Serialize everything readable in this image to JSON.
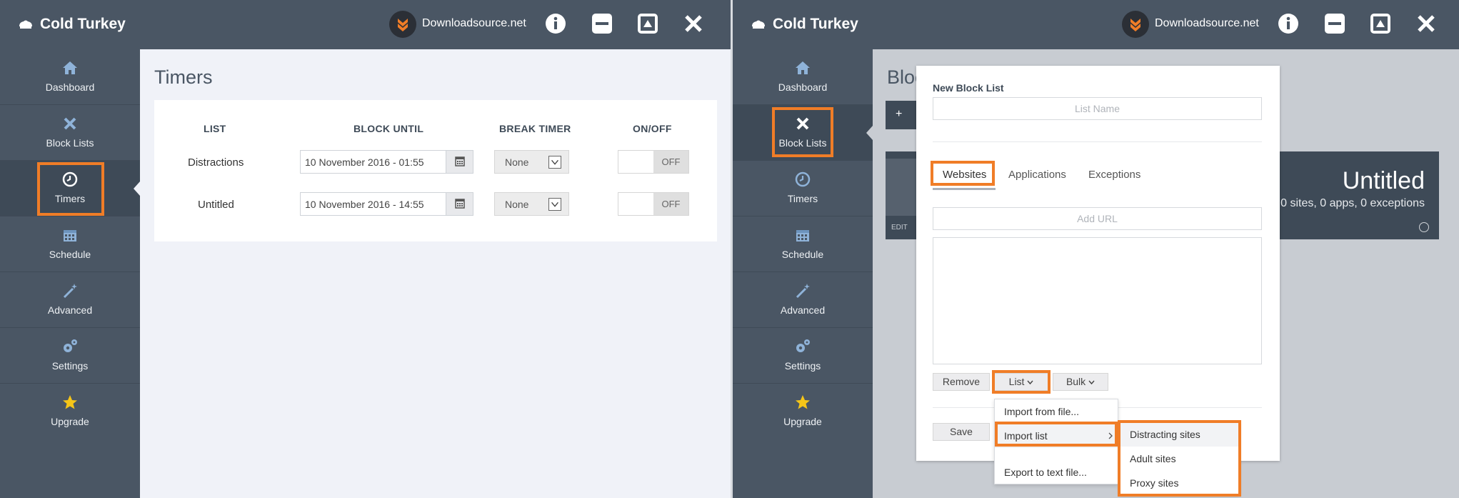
{
  "colors": {
    "titlebar": "#4a5664",
    "sidebar": "#4a5664",
    "highlight": "#f07d27",
    "content_bg": "#f0f2f8"
  },
  "left": {
    "titlebar": {
      "app_name": "Cold Turkey",
      "brand_text": "Downloadsource.net",
      "buttons": [
        "info-icon",
        "minimize-icon",
        "maximize-icon",
        "close-icon"
      ]
    },
    "sidebar": {
      "items": [
        {
          "label": "Dashboard",
          "icon": "home-icon"
        },
        {
          "label": "Block Lists",
          "icon": "x-icon"
        },
        {
          "label": "Timers",
          "icon": "clock-icon"
        },
        {
          "label": "Schedule",
          "icon": "calendar-icon"
        },
        {
          "label": "Advanced",
          "icon": "wand-icon"
        },
        {
          "label": "Settings",
          "icon": "gears-icon"
        },
        {
          "label": "Upgrade",
          "icon": "star-icon"
        }
      ],
      "active": "Timers"
    },
    "page_title": "Timers",
    "table": {
      "headers": [
        "LIST",
        "BLOCK UNTIL",
        "BREAK TIMER",
        "ON/OFF"
      ],
      "rows": [
        {
          "name": "Distractions",
          "block_until": "10 November 2016 - 01:55",
          "break_timer": "None",
          "toggle": "OFF"
        },
        {
          "name": "Untitled",
          "block_until": "10 November 2016 - 14:55",
          "break_timer": "None",
          "toggle": "OFF"
        }
      ]
    }
  },
  "right": {
    "titlebar": {
      "app_name": "Cold Turkey",
      "brand_text": "Downloadsource.net"
    },
    "sidebar": {
      "items": [
        {
          "label": "Dashboard"
        },
        {
          "label": "Block Lists"
        },
        {
          "label": "Timers"
        },
        {
          "label": "Schedule"
        },
        {
          "label": "Advanced"
        },
        {
          "label": "Settings"
        },
        {
          "label": "Upgrade"
        }
      ],
      "active": "Block Lists"
    },
    "background": {
      "title": "Bloc",
      "add_button": "+",
      "card_edit": "EDIT",
      "card_name": "Untitled",
      "card_stats": "0 sites, 0 apps, 0 exceptions"
    },
    "modal": {
      "heading": "New Block List",
      "list_name_placeholder": "List Name",
      "tabs": [
        "Websites",
        "Applications",
        "Exceptions"
      ],
      "active_tab": "Websites",
      "add_url_placeholder": "Add URL",
      "buttons": {
        "remove": "Remove",
        "list": "List",
        "bulk": "Bulk",
        "save": "Save"
      }
    },
    "list_menu": {
      "items": [
        "Import from file...",
        "Import list",
        "Export to text file..."
      ]
    },
    "import_submenu": {
      "items": [
        "Distracting sites",
        "Adult sites",
        "Proxy sites"
      ]
    }
  }
}
